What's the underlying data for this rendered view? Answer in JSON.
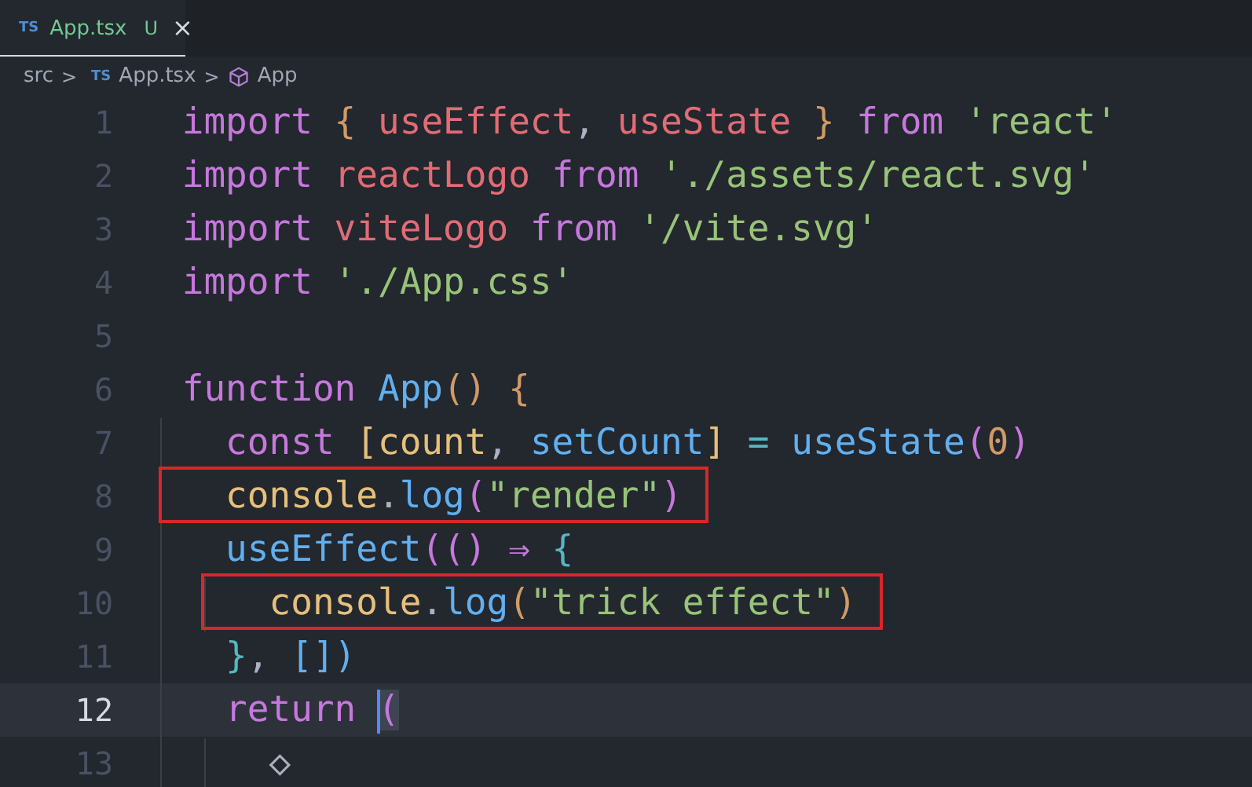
{
  "tabs": [
    {
      "language": "TS",
      "label": "App.tsx",
      "status": "U",
      "close": "×",
      "selected": true
    }
  ],
  "breadcrumb": {
    "folder": "src",
    "separator_1": ">",
    "file_icon": "TS",
    "file": "App.tsx",
    "separator_2": ">",
    "symbol": "App"
  },
  "lines": [
    {
      "number": "1",
      "current": false,
      "cursor": false,
      "boxed": false,
      "tokens": [
        {
          "text": "import ",
          "kind": "keyword"
        },
        {
          "text": "{",
          "kind": "brace"
        },
        {
          "text": " useEffect",
          "kind": "variable"
        },
        {
          "text": ", ",
          "kind": "punct"
        },
        {
          "text": "useState ",
          "kind": "variable"
        },
        {
          "text": "}",
          "kind": "brace"
        },
        {
          "text": " from ",
          "kind": "keyword"
        },
        {
          "text": "'react'",
          "kind": "string"
        }
      ]
    },
    {
      "number": "2",
      "current": false,
      "cursor": false,
      "boxed": false,
      "tokens": [
        {
          "text": "import",
          "kind": "keyword"
        },
        {
          "text": " reactLogo ",
          "kind": "variable"
        },
        {
          "text": "from ",
          "kind": "keyword"
        },
        {
          "text": "'./assets/react.svg'",
          "kind": "string"
        }
      ]
    },
    {
      "number": "3",
      "current": false,
      "cursor": false,
      "boxed": false,
      "tokens": [
        {
          "text": "import",
          "kind": "keyword"
        },
        {
          "text": " viteLogo ",
          "kind": "variable"
        },
        {
          "text": "from ",
          "kind": "keyword"
        },
        {
          "text": "'/vite.svg'",
          "kind": "string"
        }
      ]
    },
    {
      "number": "4",
      "current": false,
      "cursor": false,
      "boxed": false,
      "tokens": [
        {
          "text": "import ",
          "kind": "keyword"
        },
        {
          "text": "'./App.css'",
          "kind": "string"
        }
      ]
    },
    {
      "number": "5",
      "current": false,
      "cursor": false,
      "boxed": false
    },
    {
      "number": "6",
      "current": false,
      "cursor": false,
      "boxed": false,
      "tokens": [
        {
          "text": "function ",
          "kind": "keyword"
        },
        {
          "text": "App",
          "kind": "function"
        },
        {
          "text": "() {",
          "kind": "brace"
        }
      ]
    },
    {
      "number": "7",
      "current": false,
      "cursor": false,
      "boxed": false,
      "tokens": [
        {
          "text": "  const ",
          "kind": "keyword"
        },
        {
          "text": "[count",
          "kind": "object"
        },
        {
          "text": ", ",
          "kind": "punct"
        },
        {
          "text": "setCount",
          "kind": "function"
        },
        {
          "text": "]",
          "kind": "object"
        },
        {
          "text": " = ",
          "kind": "operator"
        },
        {
          "text": "useState",
          "kind": "function"
        },
        {
          "text": "(",
          "kind": "keyword"
        },
        {
          "text": "0",
          "kind": "number"
        },
        {
          "text": ")",
          "kind": "keyword"
        }
      ]
    },
    {
      "number": "8",
      "current": false,
      "cursor": false,
      "boxed": true,
      "tokens": [
        {
          "text": "  console",
          "kind": "object"
        },
        {
          "text": ".",
          "kind": "punct"
        },
        {
          "text": "log",
          "kind": "function"
        },
        {
          "text": "(",
          "kind": "keyword"
        },
        {
          "text": "\"render\"",
          "kind": "string"
        },
        {
          "text": ")",
          "kind": "keyword"
        }
      ]
    },
    {
      "number": "9",
      "current": false,
      "cursor": false,
      "boxed": false,
      "tokens": [
        {
          "text": "  useEffect",
          "kind": "function"
        },
        {
          "text": "(() ⇒ ",
          "kind": "keyword"
        },
        {
          "text": "{",
          "kind": "operator"
        }
      ]
    },
    {
      "number": "10",
      "current": false,
      "cursor": false,
      "boxed": true,
      "tokens": [
        {
          "text": "    console",
          "kind": "object"
        },
        {
          "text": ".",
          "kind": "punct"
        },
        {
          "text": "log",
          "kind": "function"
        },
        {
          "text": "(",
          "kind": "brace"
        },
        {
          "text": "\"trick effect\"",
          "kind": "string"
        },
        {
          "text": ")",
          "kind": "brace"
        }
      ]
    },
    {
      "number": "11",
      "current": false,
      "cursor": false,
      "boxed": false,
      "tokens": [
        {
          "text": "  }",
          "kind": "operator"
        },
        {
          "text": ", ",
          "kind": "punct"
        },
        {
          "text": "[])",
          "kind": "function"
        }
      ]
    },
    {
      "number": "12",
      "current": true,
      "cursor": true,
      "boxed": false,
      "tokens": [
        {
          "text": "  return ",
          "kind": "keyword"
        },
        {
          "text": "(",
          "kind": "keyword"
        }
      ]
    },
    {
      "number": "13",
      "current": false,
      "cursor": false,
      "boxed": false,
      "tokens": [
        {
          "text": "    ◇",
          "kind": "punct"
        }
      ]
    }
  ]
}
